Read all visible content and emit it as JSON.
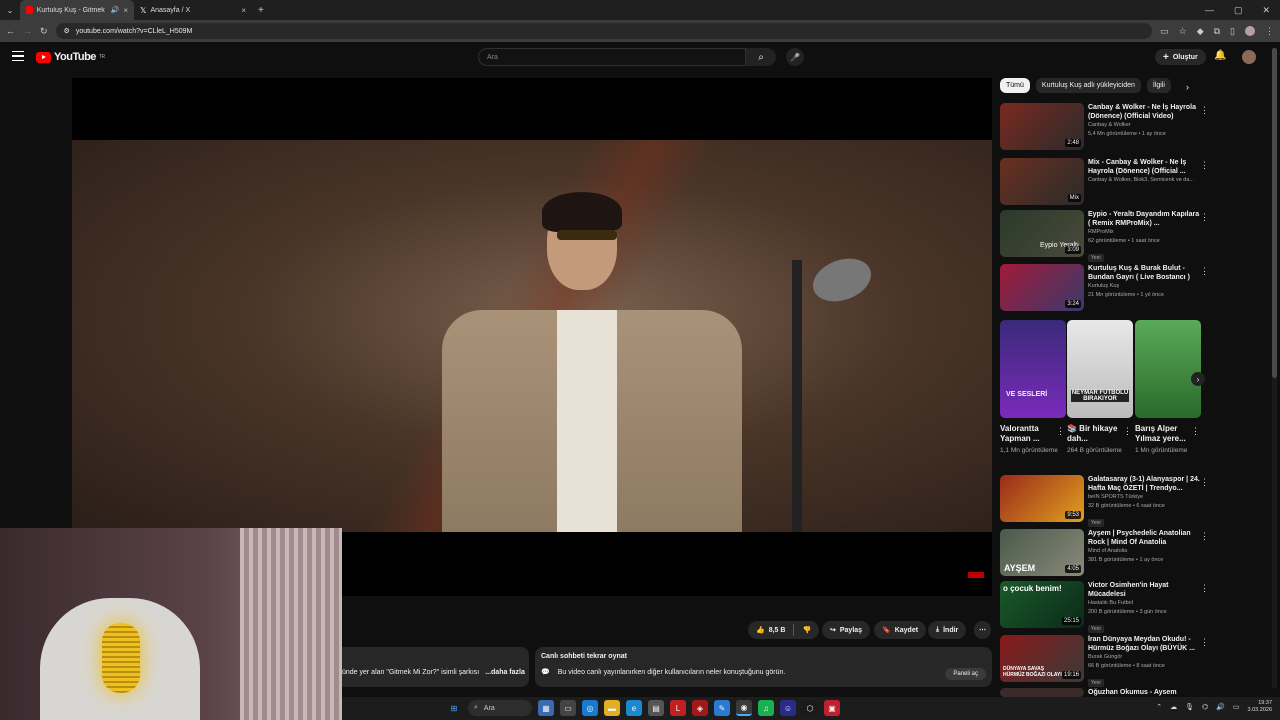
{
  "browser": {
    "tabs": [
      {
        "title": "Kurtuluş Kuş - Gitmek Mi Z",
        "active": true
      },
      {
        "title": "Anasayfa / X",
        "active": false
      }
    ],
    "url": "youtube.com/watch?v=CLleL_H509M",
    "new_tab": "+"
  },
  "header": {
    "logo_text": "YouTube",
    "logo_region": "TR",
    "search_placeholder": "Ara",
    "create_label": "Oluştur"
  },
  "player": {
    "like_count": "8,5 B",
    "share_label": "Paylaş",
    "save_label": "Kaydet",
    "download_label": "İndir"
  },
  "description": {
    "snippet": "ünde yer alan \"Gitmek Mi Zor?\" isimli şarkısı",
    "more": "...daha fazla"
  },
  "live_chat": {
    "title": "Canlı sohbeti tekrar oynat",
    "text": "Bu video canlı yayınlanırken diğer kullanıcıların neler konuştuğunu görün.",
    "button": "Paneli aç"
  },
  "chips": [
    "Tümü",
    "Kurtuluş Kuş adlı yükleyiciden",
    "İlgili"
  ],
  "recommendations": [
    {
      "title": "Canbay & Wolker - Ne İş Hayrola (Dönence) (Official Video)",
      "channel": "Canbay & Wolker",
      "meta": "5,4 Mn görüntüleme • 1 ay önce",
      "duration": "2:48",
      "color": "#7a2a20",
      "badge": ""
    },
    {
      "title": "Mix - Canbay & Wolker - Ne İş Hayrola (Dönence) (Official ...",
      "channel": "Canbay & Wolker, Blok3, Semicenk ve da...",
      "meta": "",
      "duration": "Mix",
      "color": "#6a3020",
      "badge": ""
    },
    {
      "title": "Eypio - Yeraltı Dayandım Kapılara ( Remix RMProMix) ...",
      "channel": "RMProMix",
      "meta": "62 görüntüleme • 1 saat önce",
      "duration": "3:09",
      "color": "#2a3a2a",
      "badge": "Yeni"
    },
    {
      "title": "Kurtuluş Kuş & Burak Bulut - Bundan Gayrı ( Live Bostancı )",
      "channel": "Kurtuluş Kuş",
      "meta": "21 Mn görüntüleme • 1 yıl önce",
      "duration": "3:24",
      "color": "#a01a3a",
      "badge": ""
    }
  ],
  "shorts": [
    {
      "title": "Valorantta Yapman ...",
      "meta": "1,1 Mn görüntüleme",
      "color": "#5a1a9a",
      "caption": "VE SESLERİ"
    },
    {
      "title": "📚 Bir hikaye dah...",
      "meta": "264 B görüntüleme",
      "color": "#d8d8d8",
      "caption": "NEYMAR FUTBOLU BIRAKIYOR"
    },
    {
      "title": "Barış Alper Yılmaz yere...",
      "meta": "1 Mn görüntüleme",
      "color": "#3a8a3a",
      "caption": ""
    }
  ],
  "recommendations2": [
    {
      "title": "Galatasaray (3-1) Alanyaspor | 24. Hafta Maç ÖZETİ | Trendyo...",
      "channel": "beIN SPORTS Türkiye",
      "meta": "32 B görüntüleme • 6 saat önce",
      "duration": "9:53",
      "color": "#9a2a1a",
      "badge": "Yeni"
    },
    {
      "title": "Ayşem | Psychedelic Anatolian Rock | Mind Of Anatolia",
      "channel": "Mind of Anatolia",
      "meta": "381 B görüntüleme • 1 ay önce",
      "duration": "4:05",
      "color": "#4a5a4a",
      "badge": ""
    },
    {
      "title": "Victor Osimhen'in Hayat Mücadelesi",
      "channel": "Hastalık Bu Futbol",
      "meta": "200 B görüntüleme • 3 gün önce",
      "duration": "25:15",
      "color": "#1a5a2a",
      "badge": "Yeni"
    },
    {
      "title": "İran Dünyaya Meydan Okudu! - Hürmüz Boğazı Olayı (BÜYÜK ...",
      "channel": "Burak Güngör",
      "meta": "66 B görüntüleme • 8 saat önce",
      "duration": "19:16",
      "color": "#8a1a1a",
      "badge": "Yeni"
    },
    {
      "title": "Oğuzhan Okumus - Aysem",
      "channel": "",
      "meta": "",
      "duration": "",
      "color": "#3a2a2a",
      "badge": ""
    }
  ],
  "thumb_texts": {
    "ayşem": "AYŞEM",
    "cocuk": "o çocuk benim!",
    "iran": "DÜNYAYA SAVAŞ HÜRMÜZ BOĞAZI OLAYI",
    "eypio": "Eypio Yeraltı"
  },
  "taskbar": {
    "search": "Ara",
    "time": "19:37",
    "date": "3.03.2026"
  }
}
